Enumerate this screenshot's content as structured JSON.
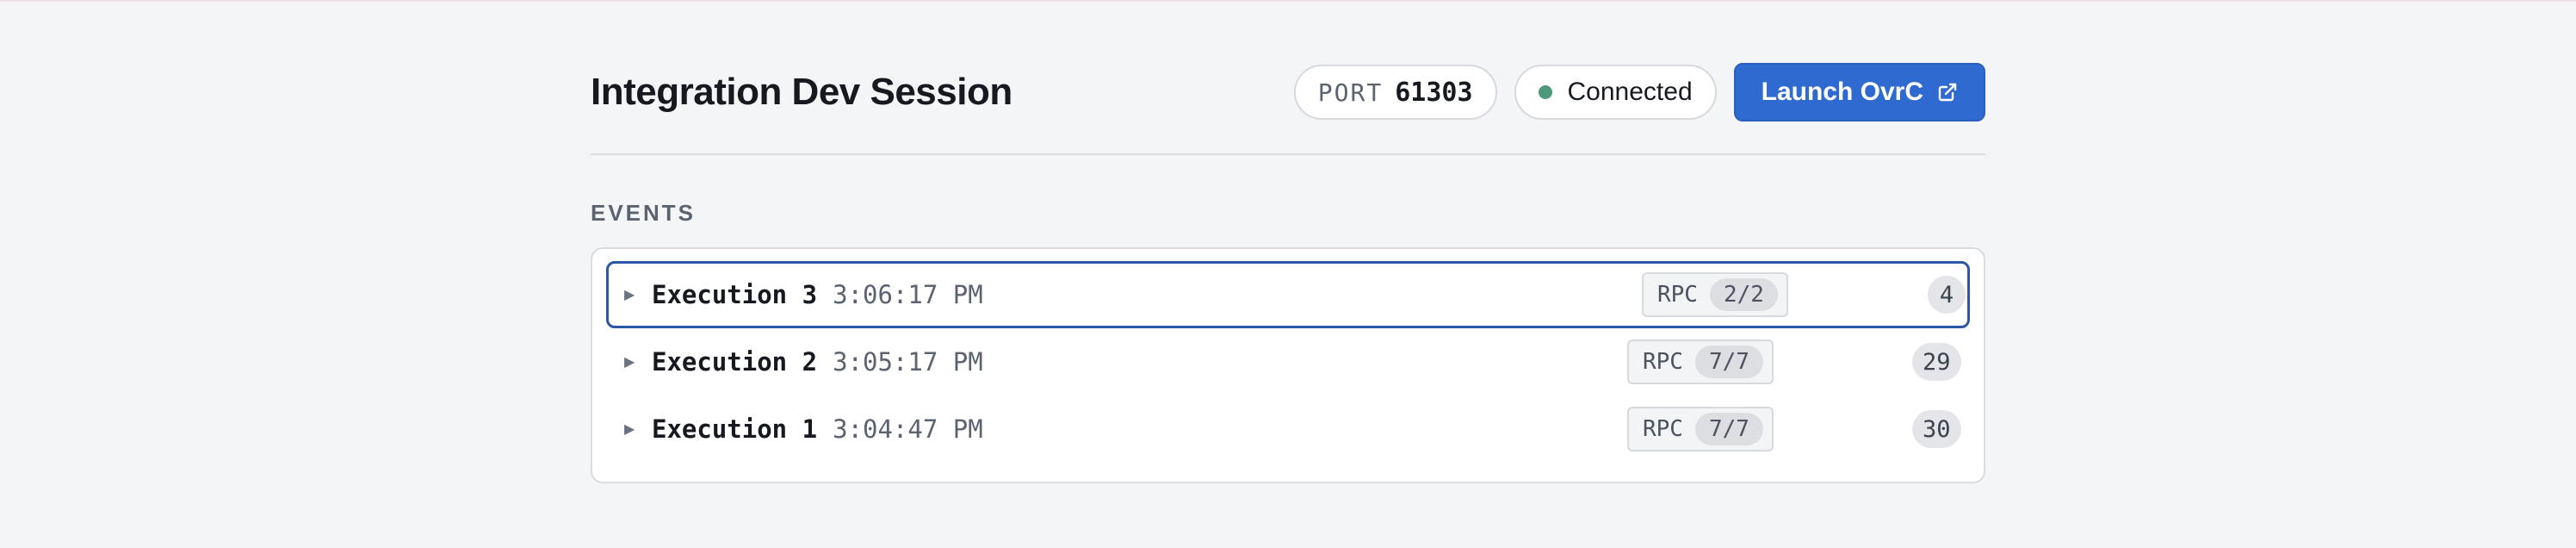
{
  "header": {
    "title": "Integration Dev Session",
    "port_label": "PORT",
    "port_value": "61303",
    "status_text": "Connected",
    "status_color": "#4d9a7b",
    "launch_label": "Launch OvrC",
    "launch_icon": "external-link-icon"
  },
  "events": {
    "section_label": "EVENTS",
    "items": [
      {
        "name": "Execution 3",
        "time": "3:06:17 PM",
        "rpc_label": "RPC",
        "rpc_count": "2/2",
        "count": "4",
        "selected": true
      },
      {
        "name": "Execution 2",
        "time": "3:05:17 PM",
        "rpc_label": "RPC",
        "rpc_count": "7/7",
        "count": "29",
        "selected": false
      },
      {
        "name": "Execution 1",
        "time": "3:04:47 PM",
        "rpc_label": "RPC",
        "rpc_count": "7/7",
        "count": "30",
        "selected": false
      }
    ]
  },
  "colors": {
    "accent": "#2f6ad1",
    "selected_border": "#2b57a8",
    "background": "#f4f5f7"
  }
}
